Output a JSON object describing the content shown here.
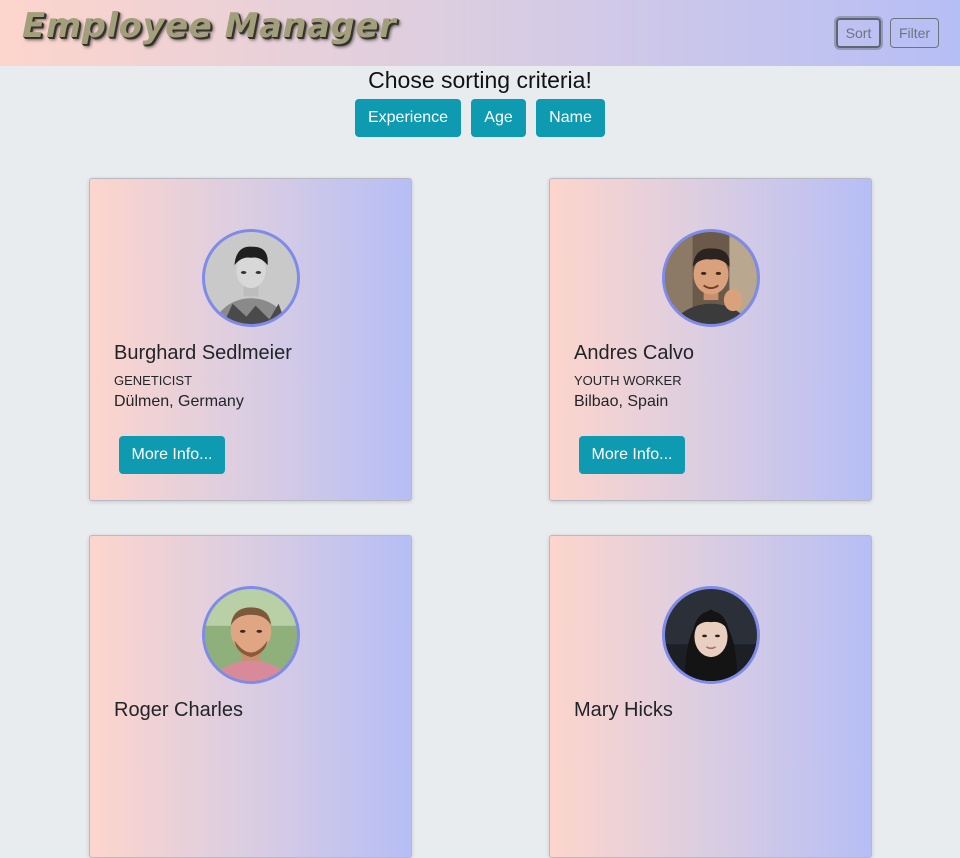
{
  "app": {
    "title": "Employee Manager"
  },
  "navbar": {
    "sort_label": "Sort",
    "filter_label": "Filter"
  },
  "sorting": {
    "title": "Chose sorting criteria!",
    "options": [
      "Experience",
      "Age",
      "Name"
    ]
  },
  "employees": [
    {
      "name": "Burghard Sedlmeier",
      "job": "GENETICIST",
      "location": "Dülmen, Germany",
      "button": "More Info..."
    },
    {
      "name": "Andres Calvo",
      "job": "YOUTH WORKER",
      "location": "Bilbao, Spain",
      "button": "More Info..."
    },
    {
      "name": "Roger Charles",
      "job": "",
      "location": "",
      "button": ""
    },
    {
      "name": "Mary Hicks",
      "job": "",
      "location": "",
      "button": ""
    }
  ],
  "colors": {
    "accent": "#0e9ab1",
    "background": "#e9ecef",
    "gradient_start": "#fdd5cc",
    "gradient_end": "#b6bef6",
    "avatar_border": "#7f8bea"
  }
}
